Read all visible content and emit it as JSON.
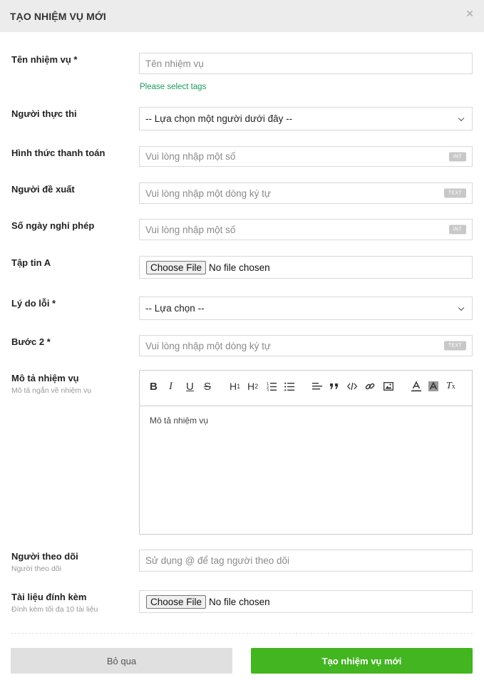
{
  "header": {
    "title": "TẠO NHIỆM VỤ MỚI",
    "close_icon": "close-icon"
  },
  "form": {
    "task_name": {
      "label": "Tên nhiệm vụ *",
      "placeholder": "Tên nhiệm vụ",
      "hint": "Please select tags"
    },
    "assignee": {
      "label": "Người thực thi",
      "selected": "-- Lựa chọn một người dưới đây --"
    },
    "payment": {
      "label": "Hình thức thanh toán",
      "placeholder": "Vui lòng nhập một số",
      "badge": "INT"
    },
    "proposer": {
      "label": "Người đề xuất",
      "placeholder": "Vui lòng nhập một dòng ký tự",
      "badge": "TEXT"
    },
    "leave_days": {
      "label": "Số ngày nghỉ phép",
      "placeholder": "Vui lòng nhập một số",
      "badge": "INT"
    },
    "file_a": {
      "label": "Tập tin A",
      "button": "Choose File",
      "status": "No file chosen"
    },
    "error_reason": {
      "label": "Lý do lỗi *",
      "selected": "-- Lựa chọn --"
    },
    "step2": {
      "label": "Bước 2 *",
      "placeholder": "Vui lòng nhập một dòng ký tự",
      "badge": "TEXT"
    },
    "description": {
      "label": "Mô tả nhiệm vụ",
      "sublabel": "Mô tả ngắn về nhiệm vụ",
      "placeholder": "Mô tả nhiệm vụ",
      "toolbar": {
        "bold": "B",
        "italic": "I",
        "underline": "U",
        "strike": "S",
        "h1": "H",
        "h1_sub": "1",
        "h2": "H",
        "h2_sub": "2",
        "tx": "T",
        "tx_sub": "x"
      }
    },
    "followers": {
      "label": "Người theo dõi",
      "sublabel": "Người theo dõi",
      "placeholder": "Sử dụng @ để tag người theo dõi"
    },
    "attachments": {
      "label": "Tài liệu đính kèm",
      "sublabel": "Đính kèm tối đa 10 tài liệu",
      "button": "Choose File",
      "status": "No file chosen"
    }
  },
  "footer": {
    "cancel": "Bỏ qua",
    "submit": "Tạo nhiệm vụ mới"
  },
  "colors": {
    "accent": "#42b520",
    "hint": "#1a9d5c",
    "header_bg": "#ececec"
  }
}
